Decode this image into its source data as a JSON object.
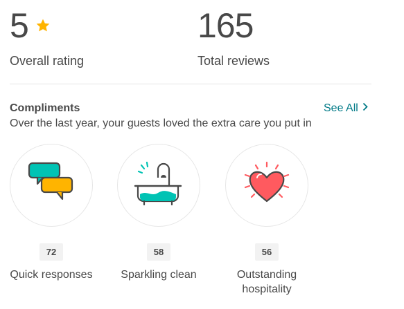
{
  "summary": {
    "rating_value": "5",
    "rating_label": "Overall rating",
    "reviews_value": "165",
    "reviews_label": "Total reviews"
  },
  "compliments": {
    "title": "Compliments",
    "see_all_label": "See All",
    "subtitle": "Over the last year, your guests loved the extra care you put in",
    "items": [
      {
        "icon": "chat-bubbles-icon",
        "count": "72",
        "label": "Quick responses"
      },
      {
        "icon": "bathtub-icon",
        "count": "58",
        "label": "Sparkling clean"
      },
      {
        "icon": "heart-icon",
        "count": "56",
        "label": "Outstanding hospitality"
      }
    ]
  },
  "colors": {
    "text": "#484848",
    "link": "#007a87",
    "star": "#ffb400",
    "teal": "#00c3b4",
    "yellow": "#ffb400",
    "coral": "#ff5a5f"
  }
}
